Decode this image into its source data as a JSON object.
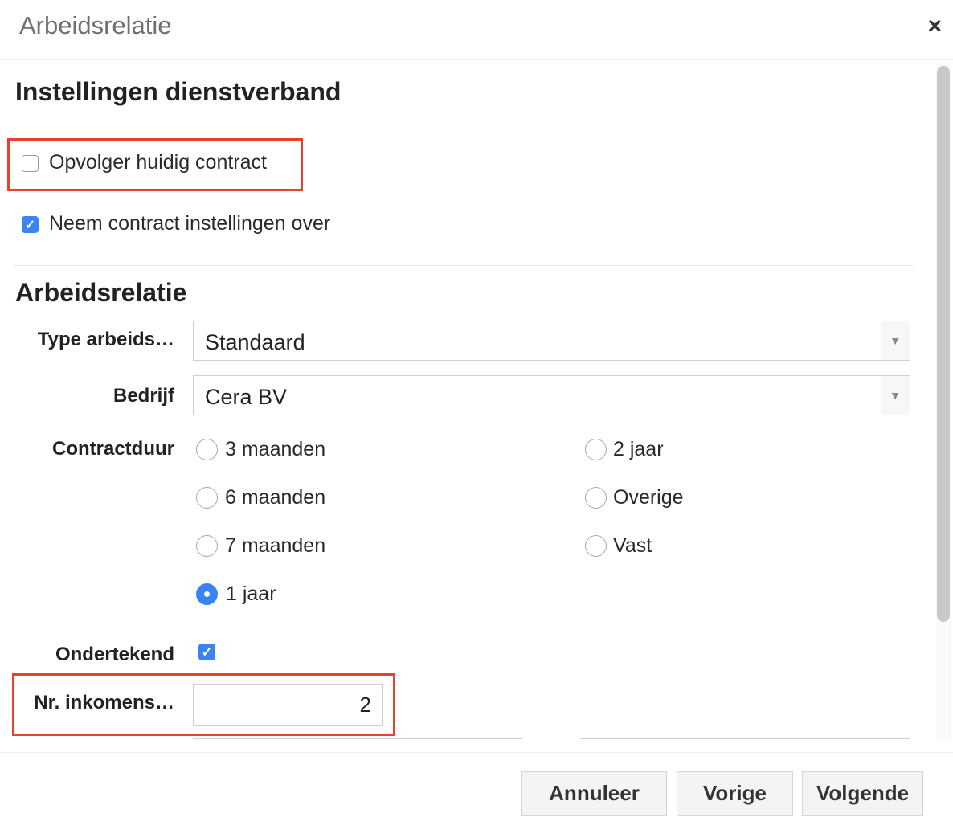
{
  "dialog": {
    "title": "Arbeidsrelatie",
    "close_icon": "×"
  },
  "settings": {
    "heading": "Instellingen dienstverband",
    "successor_label": "Opvolger huidig contract",
    "successor_checked": false,
    "take_over_label": "Neem contract instellingen over",
    "take_over_checked": true
  },
  "relation": {
    "heading": "Arbeidsrelatie",
    "type_label": "Type arbeids…",
    "type_value": "Standaard",
    "company_label": "Bedrijf",
    "company_value": "Cera BV",
    "duration_label": "Contractduur",
    "duration_options": [
      {
        "label": "3 maanden",
        "selected": false
      },
      {
        "label": "6 maanden",
        "selected": false
      },
      {
        "label": "7 maanden",
        "selected": false
      },
      {
        "label": "1 jaar",
        "selected": true
      },
      {
        "label": "2 jaar",
        "selected": false
      },
      {
        "label": "Overige",
        "selected": false
      },
      {
        "label": "Vast",
        "selected": false
      }
    ],
    "signed_label": "Ondertekend",
    "signed_checked": true,
    "income_label": "Nr. inkomens…",
    "income_value": "2"
  },
  "footer": {
    "cancel_label": "Annuleer",
    "previous_label": "Vorige",
    "next_label": "Volgende"
  },
  "colors": {
    "accent": "#3a84f2",
    "highlight": "#e8432a"
  }
}
